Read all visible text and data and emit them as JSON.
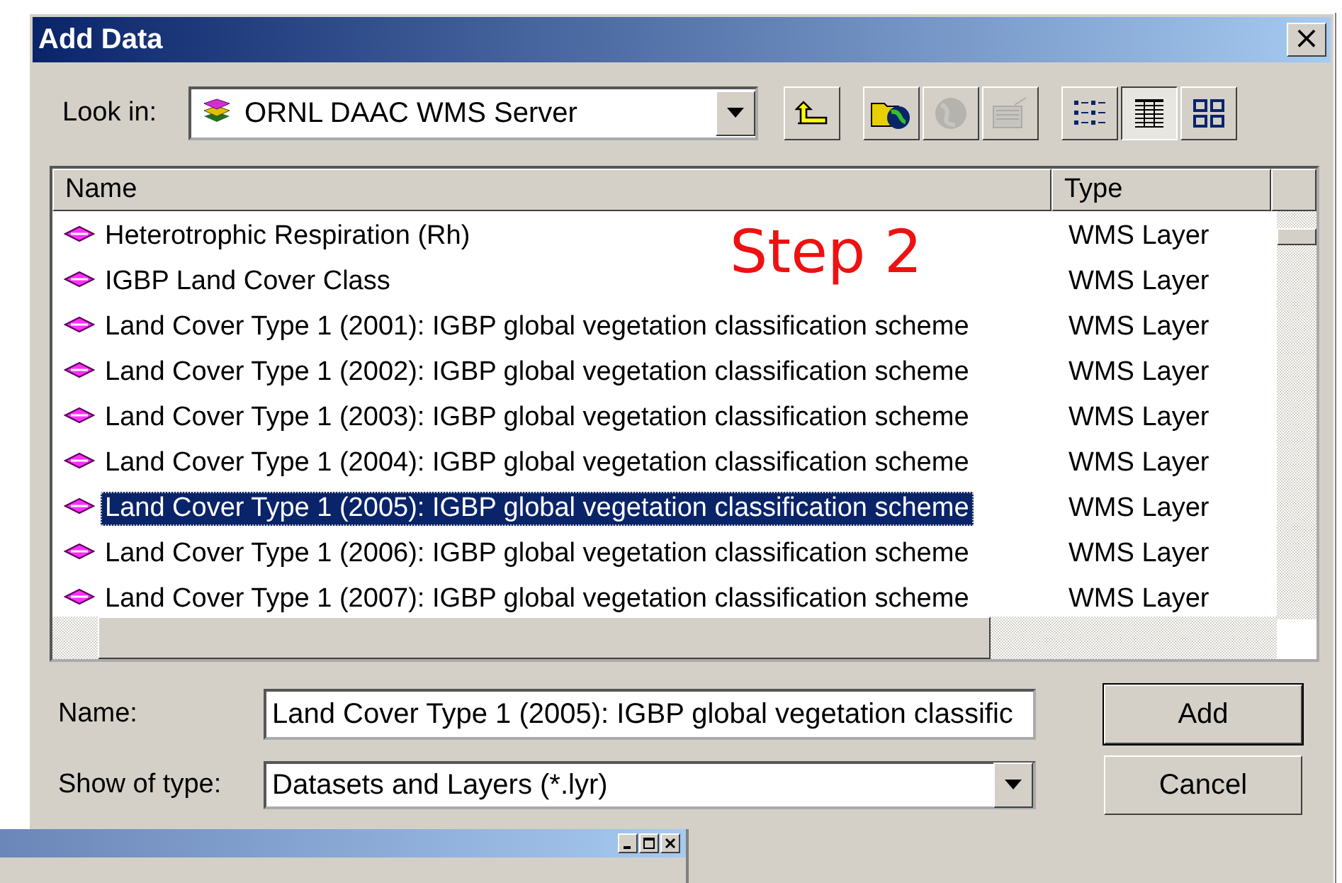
{
  "window": {
    "title": "Add Data",
    "close": "×"
  },
  "look_in": {
    "label": "Look in:",
    "value": "ORNL DAAC WMS Server"
  },
  "toolbar": [
    {
      "kind": "up",
      "disabled": false
    },
    {
      "kind": "connect",
      "disabled": false
    },
    {
      "kind": "disconnect",
      "disabled": true
    },
    {
      "kind": "catalog",
      "disabled": true
    }
  ],
  "views": [
    {
      "kind": "list",
      "selected": false
    },
    {
      "kind": "details",
      "selected": true
    },
    {
      "kind": "thumbnails",
      "selected": false
    }
  ],
  "table": {
    "columns": [
      "Name",
      "Type"
    ],
    "rows": [
      {
        "name": "Heterotrophic Respiration (Rh)",
        "type": "WMS Layer",
        "selected": false
      },
      {
        "name": "IGBP Land Cover Class",
        "type": "WMS Layer",
        "selected": false
      },
      {
        "name": "Land Cover Type 1 (2001): IGBP global vegetation classification scheme",
        "type": "WMS Layer",
        "selected": false
      },
      {
        "name": "Land Cover Type 1 (2002): IGBP global vegetation classification scheme",
        "type": "WMS Layer",
        "selected": false
      },
      {
        "name": "Land Cover Type 1 (2003): IGBP global vegetation classification scheme",
        "type": "WMS Layer",
        "selected": false
      },
      {
        "name": "Land Cover Type 1 (2004): IGBP global vegetation classification scheme",
        "type": "WMS Layer",
        "selected": false
      },
      {
        "name": "Land Cover Type 1 (2005): IGBP global vegetation classification scheme",
        "type": "WMS Layer",
        "selected": true
      },
      {
        "name": "Land Cover Type 1 (2006): IGBP global vegetation classification scheme",
        "type": "WMS Layer",
        "selected": false
      },
      {
        "name": "Land Cover Type 1 (2007): IGBP global vegetation classification scheme",
        "type": "WMS Layer",
        "selected": false
      }
    ]
  },
  "annotation": "Step 2",
  "name_field": {
    "label": "Name:",
    "value": "Land Cover Type 1 (2005): IGBP global vegetation classific"
  },
  "type_field": {
    "label": "Show of type:",
    "value": "Datasets and Layers (*.lyr)"
  },
  "buttons": [
    {
      "label": "Add",
      "default": true
    },
    {
      "label": "Cancel",
      "default": false
    }
  ]
}
